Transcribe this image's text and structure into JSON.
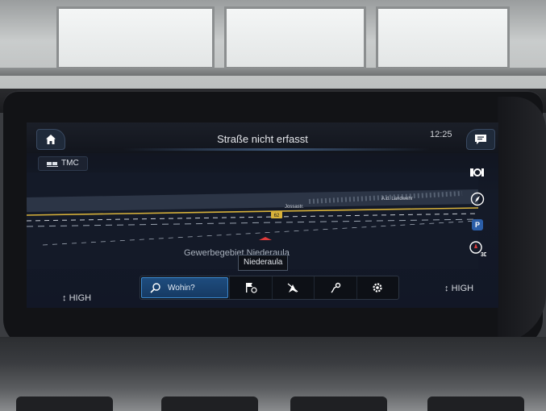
{
  "header": {
    "title": "Straße nicht erfasst",
    "time": "12:25"
  },
  "traffic": {
    "label": "TMC"
  },
  "map": {
    "streets": [
      "Jossastr.",
      "A.d. Landwehr"
    ],
    "route_shield": "62",
    "area_name": "Gewerbegebiet Niederaula",
    "place_tag": "Niederaula"
  },
  "bottom_menu": {
    "search_label": "Wohin?",
    "items": [
      "destination-flag-icon",
      "mute-guidance-icon",
      "route-icon",
      "settings-icon"
    ]
  },
  "climate": {
    "left": "HIGH",
    "right": "HIGH"
  },
  "side_buttons": [
    "poi-icon",
    "compass-icon",
    "parking-icon",
    "3d-view-icon"
  ],
  "parking_label": "P",
  "view_label": "3D",
  "colors": {
    "accent": "#3e8ad0",
    "route_yellow": "#d8b23a",
    "car_marker": "#e03a3a"
  }
}
